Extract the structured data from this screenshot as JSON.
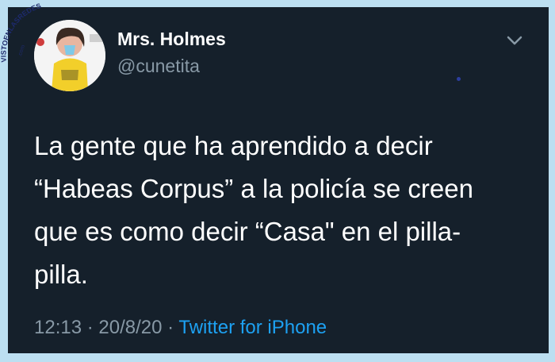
{
  "tweet": {
    "author": {
      "display_name": "Mrs. Holmes",
      "handle": "@cunetita"
    },
    "text": "La gente que ha aprendido a decir\n“Habeas Corpus” a la policía se creen\nque es como decir “Casa\" en el pilla-\npilla.",
    "time": "12:13",
    "date": "20/8/20",
    "separator": "·",
    "source": "Twitter for iPhone"
  },
  "watermark": {
    "text": "VISTOENLASREDES",
    "suffix": ".com"
  },
  "colors": {
    "background": "#15202b",
    "frame": "#bcdff1",
    "text": "#ffffff",
    "secondary_text": "#8899a6",
    "link": "#1da1f2"
  },
  "icons": {
    "menu": "chevron-down-icon"
  }
}
